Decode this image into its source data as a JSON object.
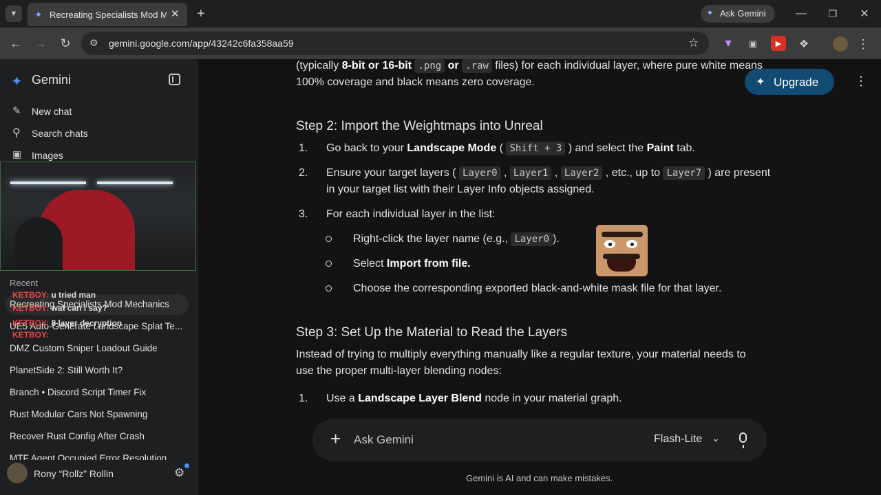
{
  "browser": {
    "tab_title": "Recreating Specialists Mod Mec",
    "ask_gemini": "Ask Gemini",
    "url": "gemini.google.com/app/43242c6fa358aa59"
  },
  "sidebar": {
    "app_name": "Gemini",
    "new_chat": "New chat",
    "search_chats": "Search chats",
    "images": "Images",
    "recent_label": "Recent",
    "recent": [
      "Recreating Specialists Mod Mechanics",
      "UE5 Auto-Generate Landscape Splat Te...",
      "DMZ Custom Sniper Loadout Guide",
      "PlanetSide 2: Still Worth It?",
      "Branch • Discord Script Timer Fix",
      "Rust Modular Cars Not Spawning",
      "Recover Rust Config After Crash",
      "MTF Agent Occupied Error Resolution"
    ],
    "user_name": "Rony “Rollz” Rollin",
    "overlay_chat": [
      {
        "user": "KETBOY:",
        "msg": "u tried man"
      },
      {
        "user": "KETBOY:",
        "msg": "wat can i say?"
      },
      {
        "user": "KETBOY:",
        "msg": "8 layer decryption"
      },
      {
        "user": "KETBOY:",
        "msg": ""
      }
    ]
  },
  "header": {
    "upgrade": "Upgrade"
  },
  "content": {
    "intro_l1_a": "(typically",
    "intro_l1_b": "8-bit or 16-bit",
    "intro_l1_c": ".png",
    "intro_l1_d": "or",
    "intro_l1_e": ".raw",
    "intro_l1_f": "files) for each individual layer, where pure white means",
    "intro_l2": "100% coverage and black means zero coverage.",
    "step2_title": "Step 2: Import the Weightmaps into Unreal",
    "s2_1_a": "Go back to your",
    "s2_1_b": "Landscape Mode",
    "s2_1_c": "Shift + 3",
    "s2_1_d": ") and select the",
    "s2_1_e": "Paint",
    "s2_1_f": "tab.",
    "s2_2_a": "Ensure your target layers (",
    "s2_2_code1": "Layer0",
    "s2_2_code2": "Layer1",
    "s2_2_code3": "Layer2",
    "s2_2_b": ", etc., up to",
    "s2_2_code4": "Layer7",
    "s2_2_c": ") are present",
    "s2_2_l2": "in your target list with their Layer Info objects assigned.",
    "s2_3": "For each individual layer in the list:",
    "b1_a": "Right-click the layer name (e.g.,",
    "b1_code": "Layer0",
    "b1_b": ").",
    "b2_a": "Select",
    "b2_b": "Import from file.",
    "b3": "Choose the corresponding exported black-and-white mask file for that layer.",
    "step3_title": "Step 3: Set Up the Material to Read the Layers",
    "s3_p_l1": "Instead of trying to multiply everything manually like a regular texture, your material needs to",
    "s3_p_l2": "use the proper multi-layer blending nodes:",
    "s3_1_a": "Use a",
    "s3_1_b": "Landscape Layer Blend",
    "s3_1_c": "node in your material graph."
  },
  "composer": {
    "placeholder": "Ask Gemini",
    "model": "Flash-Lite",
    "disclaimer": "Gemini is AI and can make mistakes."
  },
  "colors": {
    "accent_blue": "#0b57d0",
    "upgrade_bg": "#114a73"
  }
}
